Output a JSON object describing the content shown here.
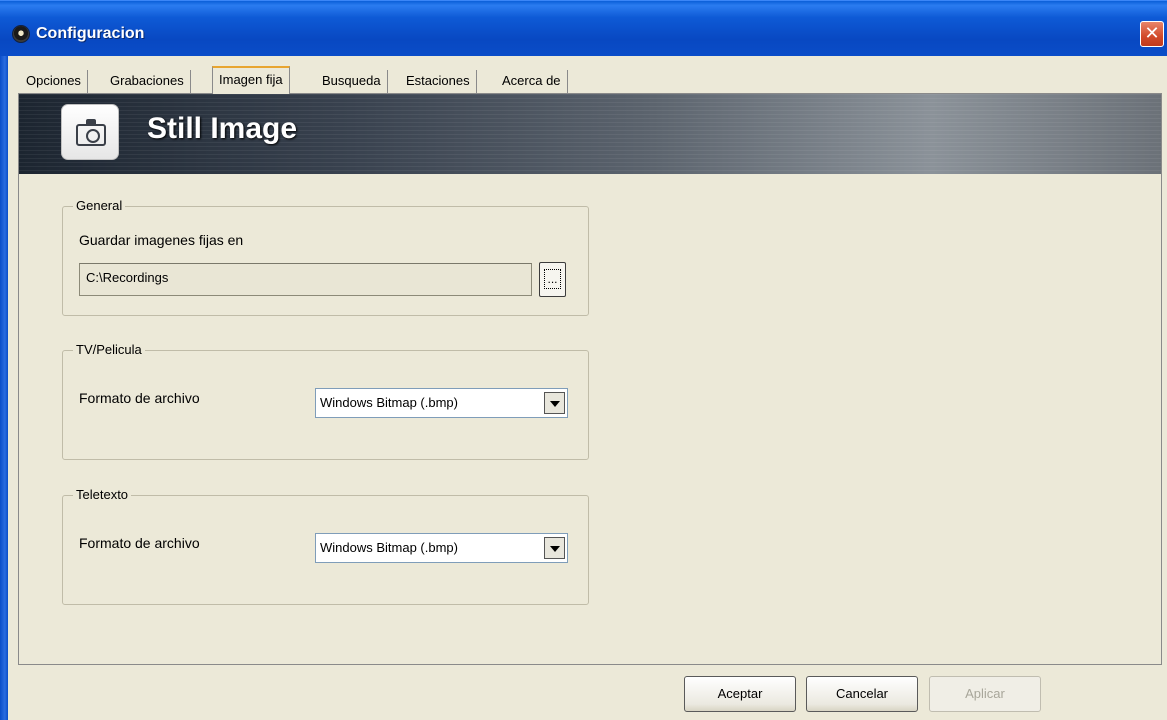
{
  "window": {
    "title": "Configuracion",
    "close_icon": "close-icon"
  },
  "tabs": [
    {
      "label": "Opciones",
      "active": false
    },
    {
      "label": "Grabaciones",
      "active": false
    },
    {
      "label": "Imagen fija",
      "active": true
    },
    {
      "label": "Busqueda",
      "active": false
    },
    {
      "label": "Estaciones",
      "active": false
    },
    {
      "label": "Acerca de",
      "active": false
    }
  ],
  "banner": {
    "title": "Still Image",
    "icon": "camera-icon"
  },
  "general": {
    "legend": "General",
    "save_label": "Guardar imagenes fijas en",
    "path_value": "C:\\Recordings",
    "browse_label": "..."
  },
  "tv": {
    "legend": "TV/Pelicula",
    "format_label": "Formato de archivo",
    "format_value": "Windows Bitmap (.bmp)"
  },
  "teletext": {
    "legend": "Teletexto",
    "format_label": "Formato de archivo",
    "format_value": "Windows Bitmap (.bmp)"
  },
  "buttons": {
    "ok": "Aceptar",
    "cancel": "Cancelar",
    "apply": "Aplicar"
  }
}
